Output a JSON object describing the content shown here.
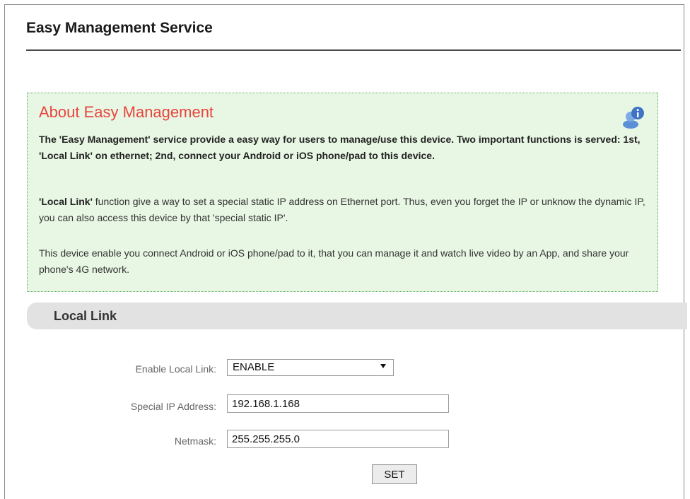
{
  "page": {
    "title": "Easy Management Service"
  },
  "about": {
    "title": "About Easy Management",
    "icon": "user-info-icon",
    "intro_bold": "The 'Easy Management' service provide a easy way for users to manage/use this device. Two important functions is served: 1st, 'Local Link' on ethernet; 2nd, connect your Android or iOS phone/pad to this device.",
    "local_link_term": "'Local Link'",
    "local_link_desc": " function give a way to set a special static IP address on Ethernet port. Thus, even you forget the IP or unknow the dynamic IP, you can also access this device by that 'special static IP'.",
    "phone_desc": "This device enable you connect Android or iOS phone/pad to it, that you can manage it and watch live video by an App, and share your phone's 4G network."
  },
  "local_link": {
    "section_title": "Local Link",
    "enable_label": "Enable Local Link:",
    "enable_value": "ENABLE",
    "ip_label": "Special IP Address:",
    "ip_value": "192.168.1.168",
    "netmask_label": "Netmask:",
    "netmask_value": "255.255.255.0",
    "set_label": "SET"
  },
  "colors": {
    "about_title": "#e8453c",
    "info_bg": "#e8f6e4",
    "info_border": "#5cae5c",
    "section_bg": "#e2e2e2"
  }
}
